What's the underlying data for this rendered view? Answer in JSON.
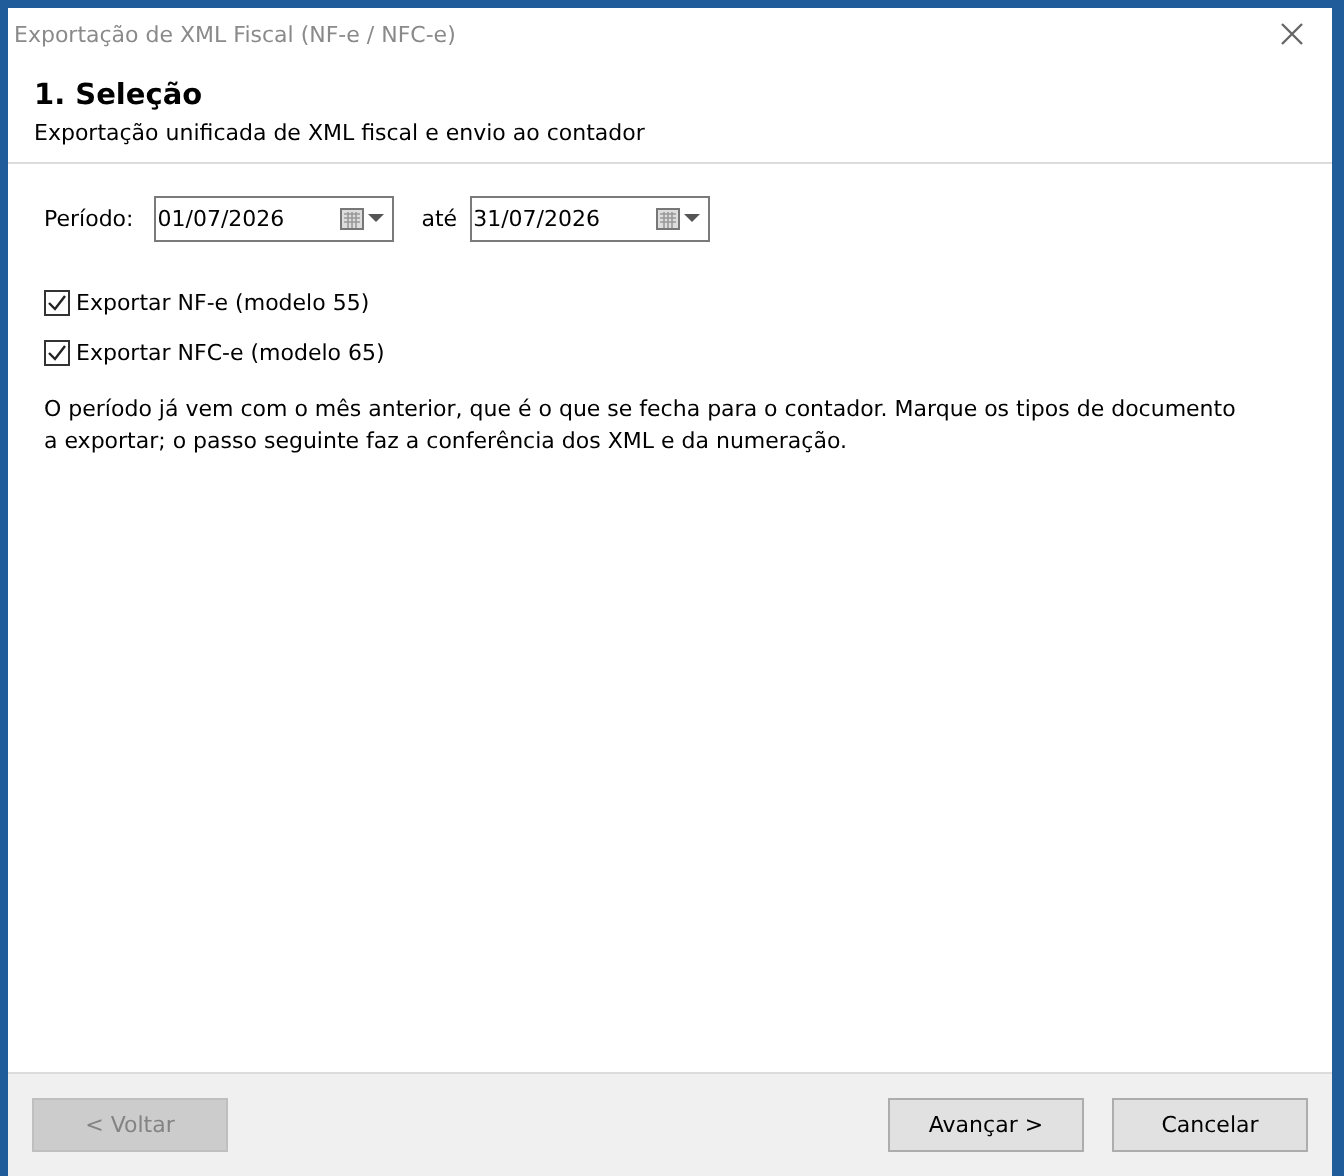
{
  "window": {
    "title": "Exportação de XML Fiscal (NF-e / NFC-e)"
  },
  "header": {
    "title": "1. Seleção",
    "subtitle": "Exportação unificada de XML fiscal e envio ao contador"
  },
  "period": {
    "label": "Período:",
    "from": "01/07/2026",
    "to_label": "até",
    "to": "31/07/2026"
  },
  "options": [
    {
      "label": "Exportar NF-e (modelo 55)",
      "checked": true
    },
    {
      "label": "Exportar NFC-e (modelo 65)",
      "checked": true
    }
  ],
  "note": "O período já vem com o mês anterior, que é o que se fecha para o contador. Marque os tipos de documento a exportar; o passo seguinte faz a conferência dos XML e da numeração.",
  "buttons": [
    {
      "label": "< Voltar",
      "disabled": true
    },
    {
      "label": "Avançar >",
      "disabled": false
    },
    {
      "label": "Cancelar",
      "disabled": false
    }
  ]
}
